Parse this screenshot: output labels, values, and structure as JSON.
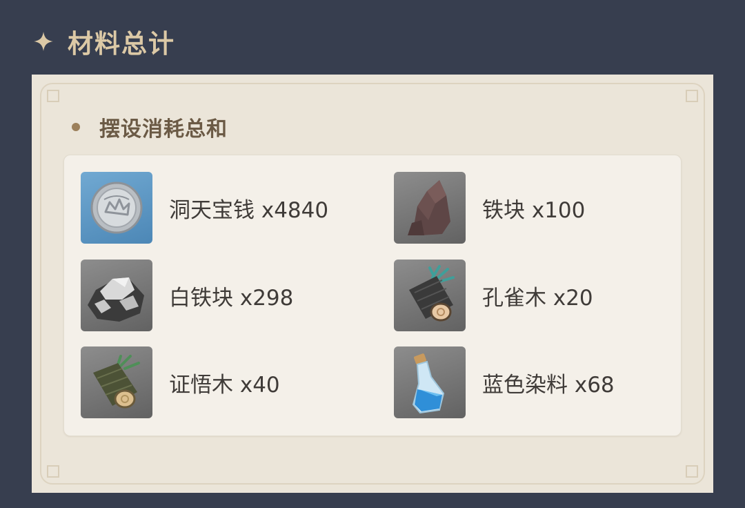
{
  "header": {
    "title": "材料总计",
    "icon": "sparkle-icon"
  },
  "section": {
    "title": "摆设消耗总和"
  },
  "items": [
    {
      "name": "洞天宝钱",
      "qty": "x4840",
      "icon": "realm-currency-coin-icon"
    },
    {
      "name": "铁块",
      "qty": "x100",
      "icon": "iron-chunk-icon"
    },
    {
      "name": "白铁块",
      "qty": "x298",
      "icon": "white-iron-chunk-icon"
    },
    {
      "name": "孔雀木",
      "qty": "x20",
      "icon": "peacock-wood-log-icon"
    },
    {
      "name": "证悟木",
      "qty": "x40",
      "icon": "adhigama-wood-log-icon"
    },
    {
      "name": "蓝色染料",
      "qty": "x68",
      "icon": "blue-dye-bottle-icon"
    }
  ],
  "colors": {
    "background": "#373e4f",
    "header_text": "#dcc9a6",
    "card": "#ebe5d9",
    "panel": "#f4f0e9",
    "section_text": "#6b5a45",
    "item_text": "#3f3b38"
  }
}
